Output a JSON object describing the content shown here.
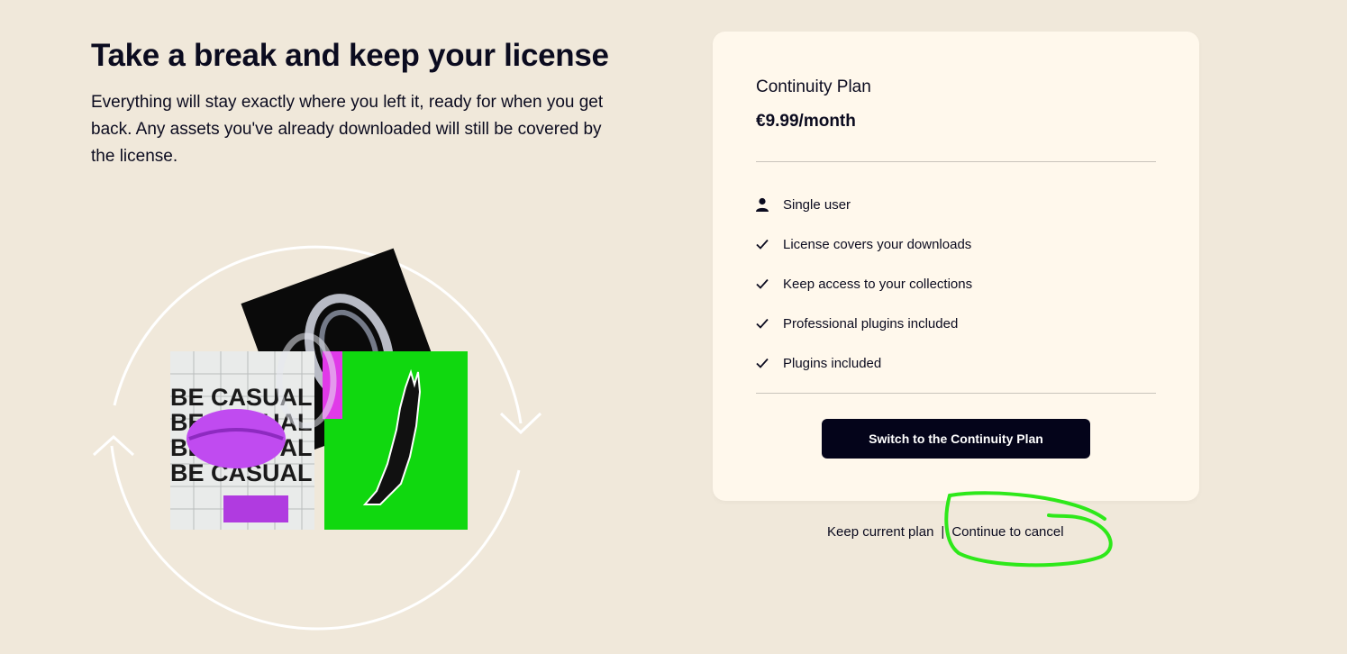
{
  "page": {
    "headline": "Take a break and keep your license",
    "subtext": "Everything will stay exactly where you left it, ready for when you get back. Any assets you've already downloaded will still be covered by the license."
  },
  "illustration": {
    "collage_text": [
      "BE CASUAL",
      "BE CASUAL",
      "BE CASUAL",
      "BE CASUAL"
    ]
  },
  "plan": {
    "name": "Continuity Plan",
    "price": "€9.99/month",
    "features": [
      {
        "icon": "user-icon",
        "label": "Single user"
      },
      {
        "icon": "check-icon",
        "label": "License covers your downloads"
      },
      {
        "icon": "check-icon",
        "label": "Keep access to your collections"
      },
      {
        "icon": "check-icon",
        "label": "Professional plugins included"
      },
      {
        "icon": "check-icon",
        "label": "Plugins included"
      }
    ],
    "cta_label": "Switch to the Continuity Plan"
  },
  "links": {
    "keep_current": "Keep current plan",
    "separator": "|",
    "continue_cancel": "Continue to cancel"
  },
  "colors": {
    "background": "#f0e8da",
    "card": "#fff8ec",
    "button": "#04041a",
    "annotation": "#2ee81a",
    "collage_green": "#10d80f",
    "collage_purple": "#c04bf0"
  }
}
